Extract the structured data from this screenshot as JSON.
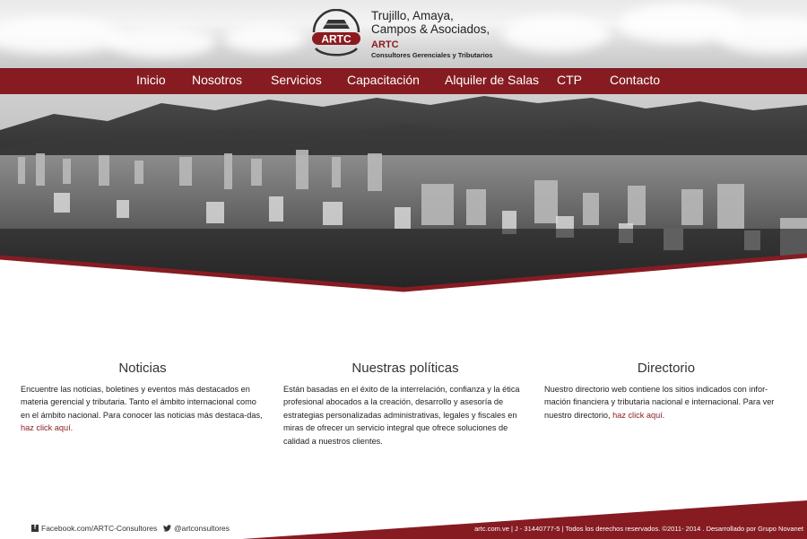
{
  "colors": {
    "brand_red": "#861c22",
    "link_red": "#8b1a1f"
  },
  "header": {
    "firm_line1": "Trujillo, Amaya,",
    "firm_line2": "Campos & Asociados,",
    "logo_text": "ARTC",
    "brand": "ARTC",
    "tagline": "Consultores Gerenciales y Tributarios"
  },
  "nav": {
    "items": [
      {
        "label": "Inicio"
      },
      {
        "label": "Nosotros"
      },
      {
        "label": "Servicios"
      },
      {
        "label": "Capacitación"
      },
      {
        "label": "Alquiler de Salas"
      },
      {
        "label": "CTP"
      },
      {
        "label": "Contacto"
      }
    ]
  },
  "hero": {
    "icon": "city-skyline-photo"
  },
  "sections": {
    "noticias": {
      "title": "Noticias",
      "body": "Encuentre las noticias, boletines y eventos más destacados en materia gerencial y tributaria. Tanto el ámbito internacional como en el ámbito nacional. Para conocer las noticias más destaca-das, ",
      "link": "haz click aquí."
    },
    "politicas": {
      "title": "Nuestras políticas",
      "body": "Están basadas en el éxito de la interrelación, confianza y la ética profesional abocados a la creación, desarrollo y asesoría de estrategias personalizadas administrativas, legales y fiscales en miras de ofrecer un servicio integral que ofrece soluciones de calidad a nuestros clientes."
    },
    "directorio": {
      "title": "Directorio",
      "body": "Nuestro directorio web contiene los sitios indicados con infor-mación financiera y tributaria nacional e internacional. Para ver nuestro directorio, ",
      "link": "haz click aquí."
    }
  },
  "footer": {
    "facebook": "Facebook.com/ARTC-Consultores",
    "twitter": "@artconsultores",
    "copyright": "artc.com.ve | J - 31440777-5 | Todos los derechos reservados. ©2011- 2014 . Desarrollado por  Grupo Novanet"
  }
}
